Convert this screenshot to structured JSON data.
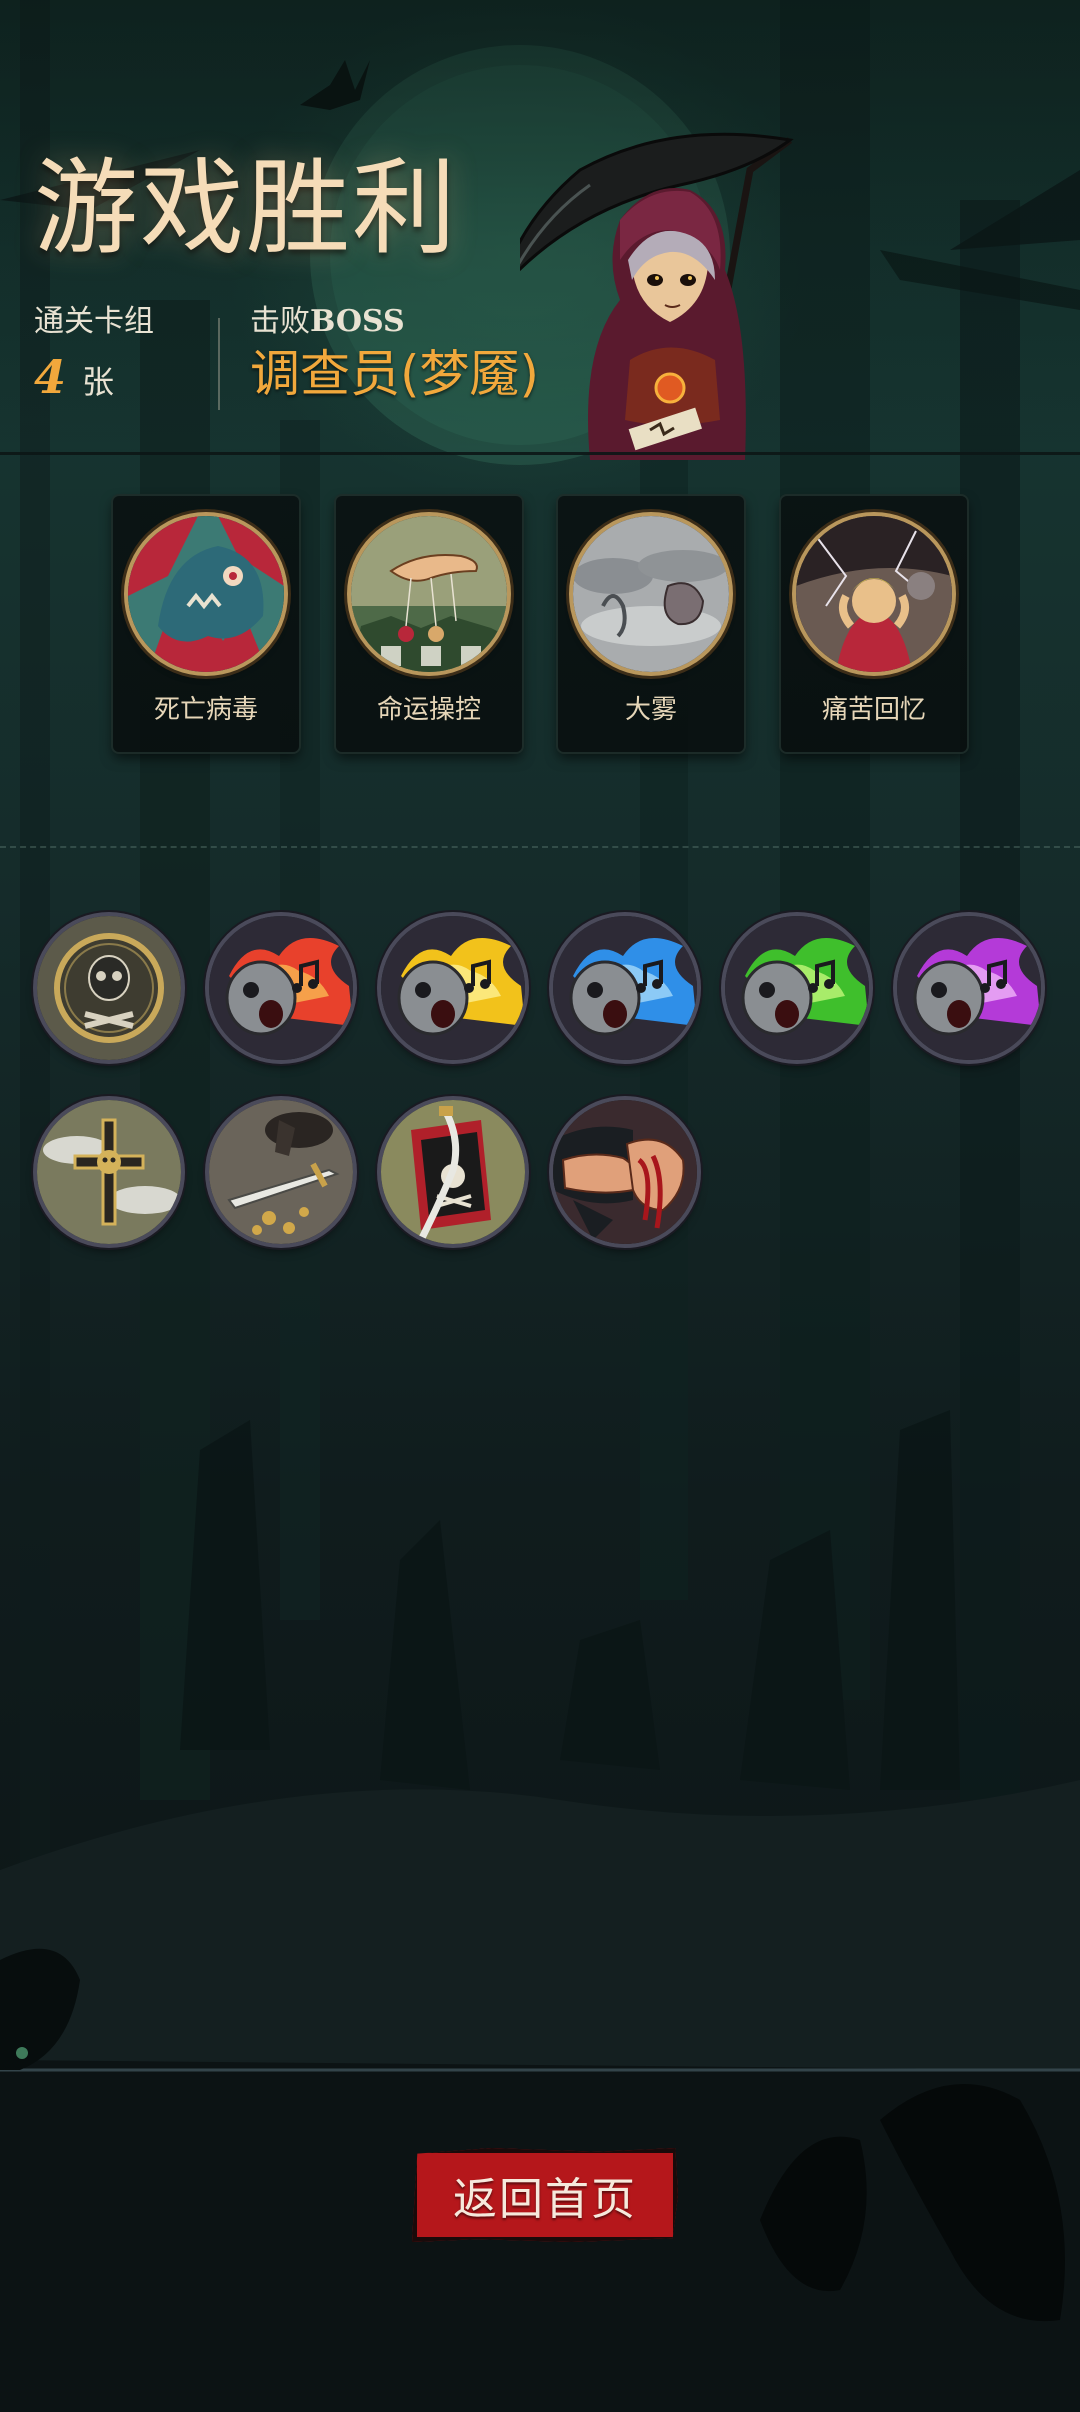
{
  "header": {
    "title": "游戏胜利",
    "deck_label": "通关卡组",
    "deck_count": "4",
    "deck_unit": "张",
    "boss_label_prefix": "击败",
    "boss_label_bold": "BOSS",
    "boss_name": "调查员(梦魇)"
  },
  "cards": [
    {
      "name": "死亡病毒",
      "icon": "virus-creature-icon"
    },
    {
      "name": "命运操控",
      "icon": "puppet-hand-icon"
    },
    {
      "name": "大雾",
      "icon": "fog-creature-icon"
    },
    {
      "name": "痛苦回忆",
      "icon": "tormented-figure-icon"
    }
  ],
  "relics": [
    {
      "icon": "skull-crossbones-coin-icon",
      "accent": "#c9a95a"
    },
    {
      "icon": "singing-skull-red-flame-icon",
      "accent": "#e8412c"
    },
    {
      "icon": "singing-skull-yellow-flame-icon",
      "accent": "#f2c21b"
    },
    {
      "icon": "singing-skull-blue-flame-icon",
      "accent": "#2f8fe8"
    },
    {
      "icon": "singing-skull-green-flame-icon",
      "accent": "#3fbf2c"
    },
    {
      "icon": "singing-skull-purple-flame-icon",
      "accent": "#b43ad8"
    },
    {
      "icon": "skull-cross-icon",
      "accent": "#d4b25a"
    },
    {
      "icon": "dagger-coins-icon",
      "accent": "#d1a84a"
    },
    {
      "icon": "pirate-flag-sword-icon",
      "accent": "#b0202a"
    },
    {
      "icon": "bloody-fist-icon",
      "accent": "#a8161c"
    }
  ],
  "actions": {
    "home_button_label": "返回首页"
  },
  "colors": {
    "title": "#f5dcb8",
    "accent_orange": "#f1a83c",
    "button_red": "#b5171b"
  }
}
